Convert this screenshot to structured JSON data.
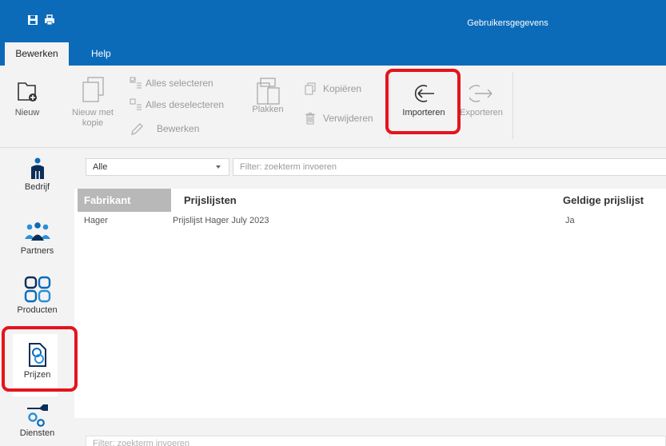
{
  "window": {
    "title": "Gebruikersgegevens",
    "quick_access": [
      "save-icon",
      "print-icon"
    ],
    "accent_color": "#0b6bb8"
  },
  "tabs": [
    {
      "label": "Bewerken",
      "active": true
    },
    {
      "label": "Help",
      "active": false
    }
  ],
  "ribbon": {
    "nieuw": "Nieuw",
    "nieuw_met_kopie_1": "Nieuw met",
    "nieuw_met_kopie_2": "kopie",
    "alles_selecteren": "Alles selecteren",
    "alles_deselecteren": "Alles deselecteren",
    "bewerken": "Bewerken",
    "plakken": "Plakken",
    "kopieren": "Kopiëren",
    "verwijderen": "Verwijderen",
    "importeren": "Importeren",
    "exporteren": "Exporteren"
  },
  "nav": [
    {
      "label": "Bedrijf",
      "icon": "building-icon"
    },
    {
      "label": "Partners",
      "icon": "partners-icon"
    },
    {
      "label": "Producten",
      "icon": "products-grid-icon"
    },
    {
      "label": "Prijzen",
      "icon": "prices-document-icon",
      "selected": true
    },
    {
      "label": "Diensten",
      "icon": "wrench-gears-icon"
    }
  ],
  "filter": {
    "select_value": "Alle",
    "placeholder": "Filter: zoekterm invoeren",
    "bottom_placeholder": "Filter: zoekterm invoeren"
  },
  "grid": {
    "columns": [
      "Fabrikant",
      "Prijslijsten",
      "Geldige prijslijst"
    ],
    "rows": [
      {
        "fabrikant": "Hager",
        "prijslijst": "Prijslijst Hager July 2023",
        "geldig": "Ja"
      }
    ]
  },
  "highlight_color": "#e4141e"
}
